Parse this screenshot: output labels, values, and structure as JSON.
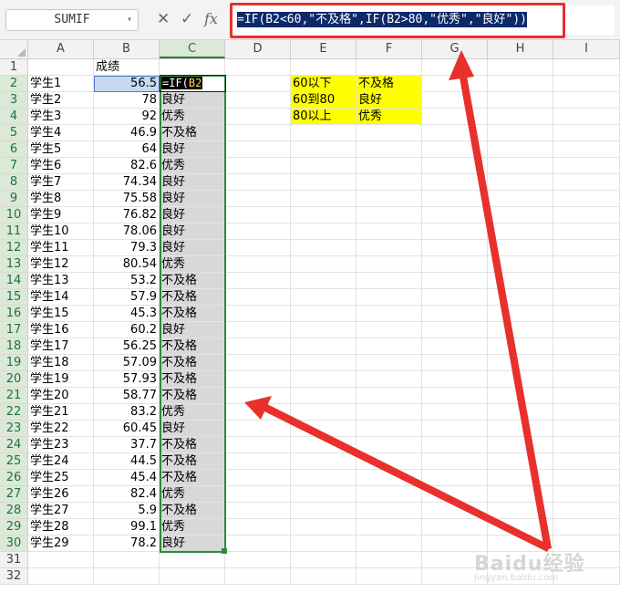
{
  "formula_bar": {
    "name_box": "SUMIF",
    "cancel_glyph": "✕",
    "enter_glyph": "✓",
    "fx_label": "fx",
    "formula": "=IF(B2<60,\"不及格\",IF(B2>80,\"优秀\",\"良好\"))"
  },
  "columns": [
    "A",
    "B",
    "C",
    "D",
    "E",
    "F",
    "G",
    "H",
    "I"
  ],
  "header_row": {
    "b": "成绩"
  },
  "editing_cell": {
    "prefix": "=IF(",
    "ref": "B2"
  },
  "rows": [
    {
      "name": "学生1",
      "score": "56.5",
      "grade": ""
    },
    {
      "name": "学生2",
      "score": "78",
      "grade": "良好"
    },
    {
      "name": "学生3",
      "score": "92",
      "grade": "优秀"
    },
    {
      "name": "学生4",
      "score": "46.9",
      "grade": "不及格"
    },
    {
      "name": "学生5",
      "score": "64",
      "grade": "良好"
    },
    {
      "name": "学生6",
      "score": "82.6",
      "grade": "优秀"
    },
    {
      "name": "学生7",
      "score": "74.34",
      "grade": "良好"
    },
    {
      "name": "学生8",
      "score": "75.58",
      "grade": "良好"
    },
    {
      "name": "学生9",
      "score": "76.82",
      "grade": "良好"
    },
    {
      "name": "学生10",
      "score": "78.06",
      "grade": "良好"
    },
    {
      "name": "学生11",
      "score": "79.3",
      "grade": "良好"
    },
    {
      "name": "学生12",
      "score": "80.54",
      "grade": "优秀"
    },
    {
      "name": "学生13",
      "score": "53.2",
      "grade": "不及格"
    },
    {
      "name": "学生14",
      "score": "57.9",
      "grade": "不及格"
    },
    {
      "name": "学生15",
      "score": "45.3",
      "grade": "不及格"
    },
    {
      "name": "学生16",
      "score": "60.2",
      "grade": "良好"
    },
    {
      "name": "学生17",
      "score": "56.25",
      "grade": "不及格"
    },
    {
      "name": "学生18",
      "score": "57.09",
      "grade": "不及格"
    },
    {
      "name": "学生19",
      "score": "57.93",
      "grade": "不及格"
    },
    {
      "name": "学生20",
      "score": "58.77",
      "grade": "不及格"
    },
    {
      "name": "学生21",
      "score": "83.2",
      "grade": "优秀"
    },
    {
      "name": "学生22",
      "score": "60.45",
      "grade": "良好"
    },
    {
      "name": "学生23",
      "score": "37.7",
      "grade": "不及格"
    },
    {
      "name": "学生24",
      "score": "44.5",
      "grade": "不及格"
    },
    {
      "name": "学生25",
      "score": "45.4",
      "grade": "不及格"
    },
    {
      "name": "学生26",
      "score": "82.4",
      "grade": "优秀"
    },
    {
      "name": "学生27",
      "score": "5.9",
      "grade": "不及格"
    },
    {
      "name": "学生28",
      "score": "99.1",
      "grade": "优秀"
    },
    {
      "name": "学生29",
      "score": "78.2",
      "grade": "良好"
    }
  ],
  "legend": [
    {
      "range": "60以下",
      "grade": "不及格"
    },
    {
      "range": "60到80",
      "grade": "良好"
    },
    {
      "range": "80以上",
      "grade": "优秀"
    }
  ],
  "watermark": {
    "brand": "Baidu经验",
    "url": "jingyan.baidu.com"
  },
  "colors": {
    "highlight_yellow": "#ffff00",
    "selection_green": "#2e8b3a",
    "annotation_red": "#e8302c",
    "formula_selection": "#0d2a6b"
  }
}
